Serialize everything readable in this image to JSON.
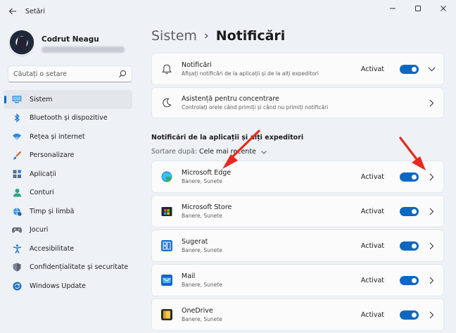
{
  "window": {
    "title": "Setări",
    "back_icon": "back-arrow-icon",
    "minimize_icon": "minimize-icon",
    "maximize_icon": "maximize-icon",
    "close_icon": "close-icon"
  },
  "profile": {
    "name": "Codrut Neagu"
  },
  "search": {
    "placeholder": "Căutați o setare"
  },
  "sidebar": {
    "items": [
      {
        "label": "Sistem",
        "icon": "monitor-icon",
        "active": true
      },
      {
        "label": "Bluetooth și dispozitive",
        "icon": "bluetooth-icon"
      },
      {
        "label": "Rețea și internet",
        "icon": "wifi-icon"
      },
      {
        "label": "Personalizare",
        "icon": "brush-icon"
      },
      {
        "label": "Aplicații",
        "icon": "apps-icon"
      },
      {
        "label": "Conturi",
        "icon": "person-icon"
      },
      {
        "label": "Timp și limbă",
        "icon": "globe-clock-icon"
      },
      {
        "label": "Jocuri",
        "icon": "gamepad-icon"
      },
      {
        "label": "Accesibilitate",
        "icon": "accessibility-icon"
      },
      {
        "label": "Confidențialitate și securitate",
        "icon": "shield-icon"
      },
      {
        "label": "Windows Update",
        "icon": "update-icon"
      }
    ]
  },
  "breadcrumb": {
    "parent": "Sistem",
    "separator": "›",
    "current": "Notificări"
  },
  "top_cards": [
    {
      "title": "Notificări",
      "subtitle": "Afișați notificări de la aplicații și de la alți expeditori",
      "status": "Activat",
      "icon": "bell-icon",
      "chevron": "chevron-down-icon"
    },
    {
      "title": "Asistență pentru concentrare",
      "subtitle": "Controlați orele când primiți și când nu primiți notificări",
      "icon": "moon-icon",
      "chevron": "chevron-right-icon"
    }
  ],
  "section": {
    "title": "Notificări de la aplicații și alți expeditori",
    "sort_label": "Sortare după:",
    "sort_value": "Cele mai recente"
  },
  "apps": [
    {
      "name": "Microsoft Edge",
      "subtitle": "Banere, Sunete",
      "status": "Activat",
      "icon": "edge-icon"
    },
    {
      "name": "Microsoft Store",
      "subtitle": "Banere, Sunete",
      "status": "Activat",
      "icon": "store-icon"
    },
    {
      "name": "Sugerat",
      "subtitle": "Banere, Sunete",
      "status": "Activat",
      "icon": "suggested-icon"
    },
    {
      "name": "Mail",
      "subtitle": "Banere, Sunete",
      "status": "Activat",
      "icon": "mail-icon"
    },
    {
      "name": "OneDrive",
      "subtitle": "Banere, Sunete",
      "status": "Activat",
      "icon": "onedrive-icon"
    }
  ],
  "colors": {
    "accent": "#0a67c2",
    "background": "#eef2f6",
    "card": "#fbfbfb",
    "annotation_arrow": "#e8281e"
  }
}
